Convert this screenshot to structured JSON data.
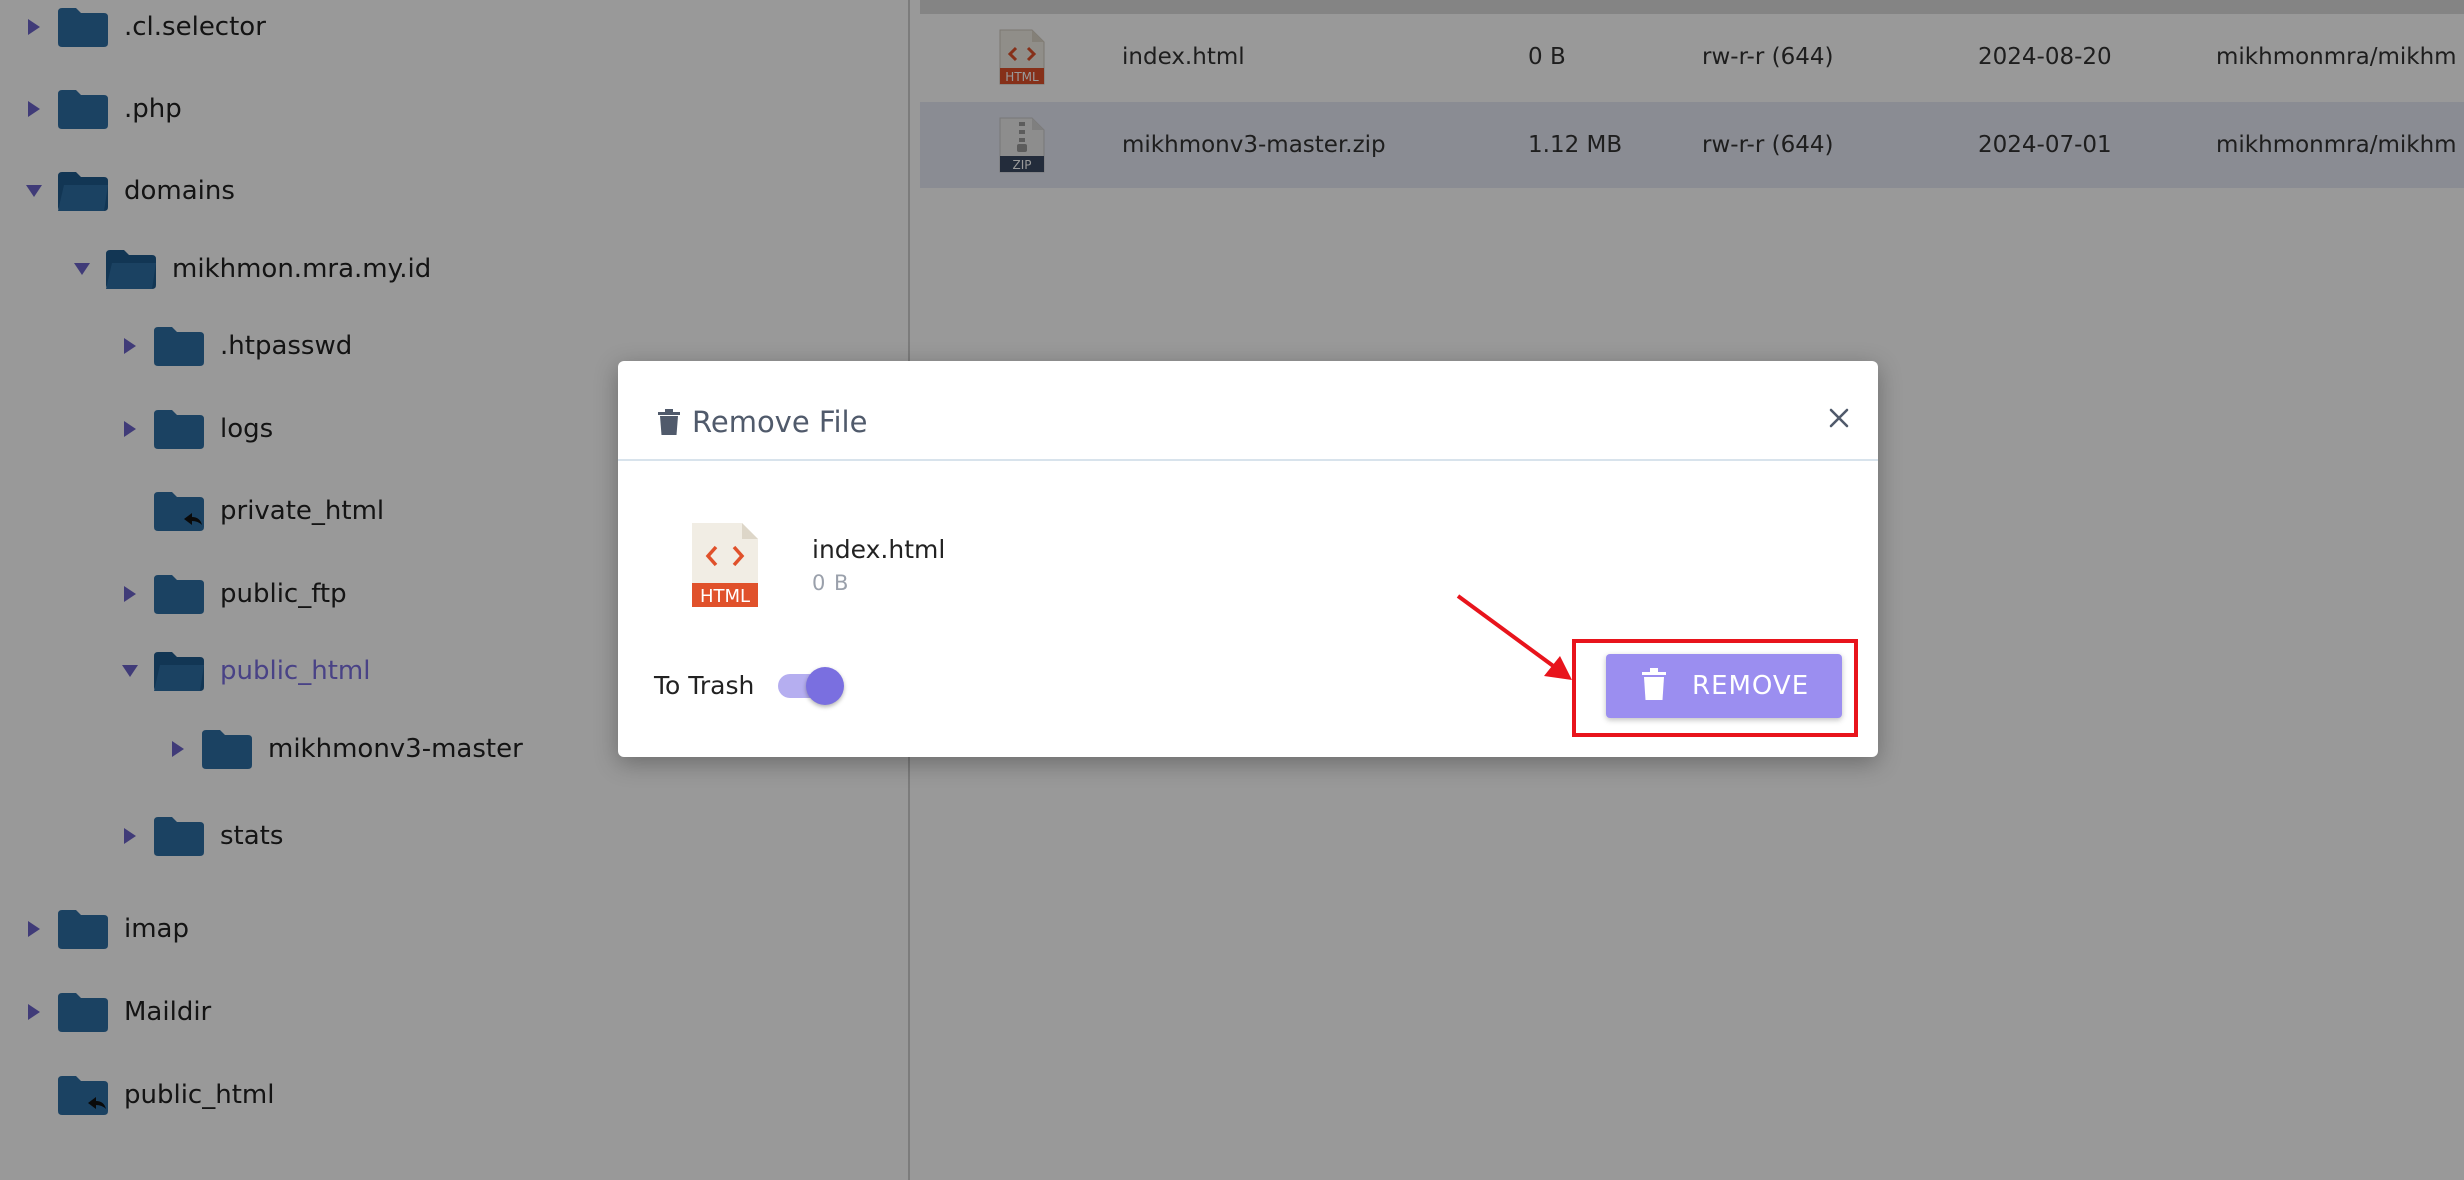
{
  "tree": {
    "items": [
      {
        "label": ".cl.selector",
        "level": 0,
        "expanded": false,
        "has_children": true,
        "link": false
      },
      {
        "label": ".php",
        "level": 0,
        "expanded": false,
        "has_children": true,
        "link": false
      },
      {
        "label": "domains",
        "level": 0,
        "expanded": true,
        "has_children": true,
        "link": false
      },
      {
        "label": "mikhmon.mra.my.id",
        "level": 1,
        "expanded": true,
        "has_children": true,
        "link": false
      },
      {
        "label": ".htpasswd",
        "level": 2,
        "expanded": false,
        "has_children": true,
        "link": false
      },
      {
        "label": "logs",
        "level": 2,
        "expanded": false,
        "has_children": true,
        "link": false
      },
      {
        "label": "private_html",
        "level": 2,
        "expanded": false,
        "has_children": false,
        "link": true
      },
      {
        "label": "public_ftp",
        "level": 2,
        "expanded": false,
        "has_children": true,
        "link": false
      },
      {
        "label": "public_html",
        "level": 2,
        "expanded": true,
        "has_children": true,
        "link": false,
        "active": true
      },
      {
        "label": "mikhmonv3-master",
        "level": 3,
        "expanded": false,
        "has_children": true,
        "link": false
      },
      {
        "label": "stats",
        "level": 2,
        "expanded": false,
        "has_children": true,
        "link": false
      },
      {
        "label": "imap",
        "level": 0,
        "expanded": false,
        "has_children": true,
        "link": false
      },
      {
        "label": "Maildir",
        "level": 0,
        "expanded": false,
        "has_children": true,
        "link": false
      },
      {
        "label": "public_html",
        "level": 0,
        "expanded": false,
        "has_children": false,
        "link": true
      }
    ]
  },
  "files": {
    "rows": [
      {
        "name": "index.html",
        "size": "0 B",
        "perms": "rw-r-r (644)",
        "date": "2024-08-20",
        "owner": "mikhmonmra/mikhm",
        "icon": "html-file-icon",
        "icon_text": "HTML",
        "selected": false
      },
      {
        "name": "mikhmonv3-master.zip",
        "size": "1.12 MB",
        "perms": "rw-r-r (644)",
        "date": "2024-07-01",
        "owner": "mikhmonmra/mikhm",
        "icon": "zip-file-icon",
        "icon_text": "ZIP",
        "selected": true
      }
    ]
  },
  "modal": {
    "title": "Remove File",
    "file_name": "index.html",
    "file_size": "0 B",
    "file_icon_text": "HTML",
    "trash_label": "To Trash",
    "trash_on": true,
    "remove_label": "REMOVE"
  },
  "colors": {
    "accent": "#7a6fe0",
    "button": "#9b8ef0",
    "folder": "#2d6ea4",
    "highlight": "#e8141c",
    "html_badge": "#e0512b"
  }
}
